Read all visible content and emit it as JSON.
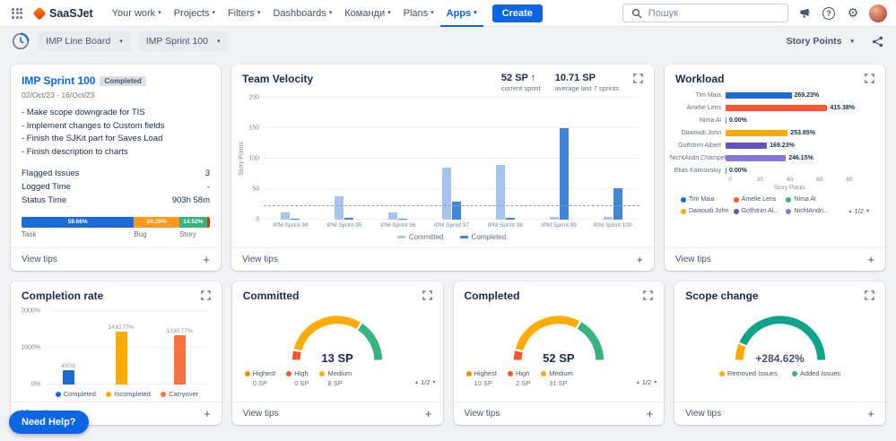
{
  "topbar": {
    "brand": "SaaSJet",
    "nav_items": [
      "Your work",
      "Projects",
      "Filters",
      "Dashboards",
      "Команди",
      "Plans",
      "Apps"
    ],
    "active_nav": "Apps",
    "create_label": "Create",
    "search_placeholder": "Пошук"
  },
  "toolbar": {
    "board_select": "IMP Line Board",
    "sprint_select": "IMP Sprint 100",
    "metric_select": "Story Points"
  },
  "common": {
    "view_tips": "View tips",
    "plus": "+"
  },
  "need_help": "Need Help?",
  "cards": {
    "sprint": {
      "title": "IMP Sprint 100",
      "badge": "Completed",
      "dates": "02/Oct/23 - 16/Oct/23",
      "goals": [
        "- Make scope downgrade for TIS",
        "- Implement changes to Custom fields",
        "- Finish the SJKit part for Saves Load",
        "- Finish description to charts"
      ],
      "stats": [
        {
          "label": "Flagged Issues",
          "value": "3"
        },
        {
          "label": "Logged Time",
          "value": "-"
        },
        {
          "label": "Status Time",
          "value": "903h 58m"
        }
      ],
      "distribution": [
        {
          "label": "Task",
          "display": "59.66%",
          "pct": 59.66,
          "color": "#1B6AD6"
        },
        {
          "label": "Bug",
          "display": "24.19%",
          "pct": 24.19,
          "color": "#FF991F"
        },
        {
          "label": "Story",
          "display": "14.52%",
          "pct": 14.52,
          "color": "#36B37E"
        },
        {
          "label": "",
          "display": "",
          "pct": 1.63,
          "color": "#DE350B"
        }
      ]
    },
    "velocity": {
      "title": "Team Velocity",
      "stat1_value": "52 SP ↑",
      "stat1_label": "current sprint",
      "stat2_value": "10.71 SP",
      "stat2_label": "average last 7 sprints",
      "chart": {
        "type": "bar",
        "ylabel": "Story Points",
        "ymax": 200,
        "yticks": [
          0,
          50,
          100,
          150,
          200
        ],
        "average_line": 22,
        "categories": [
          "IPM Sprint 94",
          "IPM Sprint 95",
          "IPM Sprint 96",
          "IPM Sprint 97",
          "IPM Sprint 98",
          "IPM Sprint 99",
          "IPM Sprint 100"
        ],
        "series": [
          {
            "name": "Committed",
            "color": "#A6C5EE",
            "values": [
              12,
              38,
              12,
              85,
              90,
              5,
              5
            ]
          },
          {
            "name": "Completed",
            "color": "#4285D8",
            "values": [
              2,
              3,
              2,
              30,
              3,
              150,
              52
            ]
          }
        ]
      }
    },
    "workload": {
      "title": "Workload",
      "chart": {
        "type": "hbar",
        "xlabel": "Story Points",
        "xmax": 80,
        "xticks": [
          0,
          20,
          40,
          60,
          80
        ],
        "rows": [
          {
            "name": "Tim Maia",
            "value": 35,
            "display": "269.23%",
            "color": "#1B6AD6"
          },
          {
            "name": "Amelie Lens",
            "value": 54,
            "display": "415.38%",
            "color": "#FF5630"
          },
          {
            "name": "Nima Al",
            "value": 0.5,
            "display": "0.00%",
            "color": "#36B37E"
          },
          {
            "name": "Dawoudi John",
            "value": 33,
            "display": "253.85%",
            "color": "#FFAB00"
          },
          {
            "name": "Golfstrim Albert",
            "value": 22,
            "display": "169.23%",
            "color": "#6554C0"
          },
          {
            "name": "NichtAndri Champel",
            "value": 32,
            "display": "246.15%",
            "color": "#8777D9"
          },
          {
            "name": "Elias Kalinovskiy",
            "value": 0.5,
            "display": "0.00%",
            "color": "#00B8D9"
          }
        ],
        "legend": [
          "Tim Maia",
          "Amelie Lens",
          "Nima Al",
          "Dawoudi John",
          "Golfstrim Al...",
          "NichtAndri..."
        ],
        "pagination": "1/2"
      }
    },
    "completion": {
      "title": "Completion rate",
      "chart": {
        "type": "bar",
        "ymax": 2000,
        "yticks": [
          "0%",
          "1000%",
          "2000%"
        ],
        "bars": [
          {
            "label": "Completed",
            "value": 400,
            "display": "400%",
            "color": "#1B6AD6"
          },
          {
            "label": "Incompleted",
            "value": 1430.77,
            "display": "1430.77%",
            "color": "#FFAB00"
          },
          {
            "label": "Carryover",
            "value": 1330.77,
            "display": "1330.77%",
            "color": "#FF7043"
          }
        ]
      }
    },
    "committed": {
      "title": "Committed",
      "gauge": {
        "value": "13 SP",
        "segments": [
          {
            "color": "#FF5630",
            "pct": 8
          },
          {
            "color": "#FFAB00",
            "pct": 60
          },
          {
            "color": "#36B37E",
            "pct": 32
          }
        ],
        "legend": [
          {
            "label": "Highest",
            "value": "0 SP",
            "color": "#FF8B00"
          },
          {
            "label": "High",
            "value": "0 SP",
            "color": "#FF5630"
          },
          {
            "label": "Medium",
            "value": "8 SP",
            "color": "#FFAB00"
          }
        ],
        "pagination": "1/2"
      }
    },
    "completed": {
      "title": "Completed",
      "gauge": {
        "value": "52 SP",
        "segments": [
          {
            "color": "#FF5630",
            "pct": 8
          },
          {
            "color": "#FFAB00",
            "pct": 58
          },
          {
            "color": "#36B37E",
            "pct": 34
          }
        ],
        "legend": [
          {
            "label": "Highest",
            "value": "10 SP",
            "color": "#FF8B00"
          },
          {
            "label": "High",
            "value": "2 SP",
            "color": "#FF5630"
          },
          {
            "label": "Medium",
            "value": "31 SP",
            "color": "#FFAB00"
          }
        ],
        "pagination": "1/2"
      }
    },
    "scope": {
      "title": "Scope change",
      "gauge": {
        "value": "+284.62%",
        "segments": [
          {
            "color": "#FFAB00",
            "pct": 13
          },
          {
            "color": "#0FA38C",
            "pct": 87
          }
        ],
        "legend": [
          {
            "label": "Removed Issues",
            "value": "",
            "color": "#FFAB00"
          },
          {
            "label": "Added Issues",
            "value": "",
            "color": "#36B37E"
          }
        ]
      }
    }
  }
}
